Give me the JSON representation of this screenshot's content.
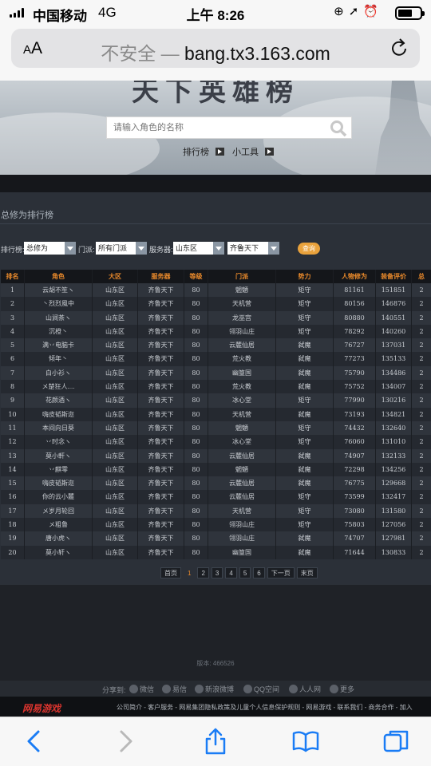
{
  "status_bar": {
    "carrier": "中国移动",
    "network": "4G",
    "time": "上午 8:26"
  },
  "address_bar": {
    "aa_big": "A",
    "aa_small": "A",
    "insecure": "不安全 — ",
    "domain": "bang.tx3.163.com"
  },
  "banner": {
    "title": "天下英雄榜",
    "search_placeholder": "请输入角色的名称",
    "links": [
      "排行榜",
      "小工具"
    ]
  },
  "panel": {
    "title": "总修为排行榜",
    "filters": {
      "rank_label": "排行榜:",
      "rank_value": "总修为",
      "school_label": "门派:",
      "school_value": "所有门派",
      "server_label": "服务器:",
      "region_value": "山东区",
      "server_value": "齐鲁天下",
      "query_button": "查询"
    }
  },
  "table": {
    "columns": [
      "排名",
      "角色",
      "大区",
      "服务器",
      "等级",
      "门派",
      "势力",
      "人物修为",
      "装备评价",
      "总"
    ],
    "rows": [
      [
        "1",
        "云胡不笙ヽ",
        "山东区",
        "齐鲁天下",
        "80",
        "魍魉",
        "矩守",
        "81161",
        "151851",
        "2"
      ],
      [
        "2",
        "丶烈烈風中",
        "山东区",
        "齐鲁天下",
        "80",
        "天机营",
        "矩守",
        "80156",
        "146876",
        "2"
      ],
      [
        "3",
        "山涧茶ヽ",
        "山东区",
        "齐鲁天下",
        "80",
        "龙巫宫",
        "矩守",
        "80880",
        "140551",
        "2"
      ],
      [
        "4",
        "沉橙丶",
        "山东区",
        "齐鲁天下",
        "80",
        "翎羽山庄",
        "矩守",
        "78292",
        "140260",
        "2"
      ],
      [
        "5",
        "满丷电脑卡",
        "山东区",
        "齐鲁天下",
        "80",
        "云麓仙居",
        "弑魔",
        "76727",
        "137031",
        "2"
      ],
      [
        "6",
        "倾年丶",
        "山东区",
        "齐鲁天下",
        "80",
        "荒火教",
        "弑魔",
        "77273",
        "135133",
        "2"
      ],
      [
        "7",
        "白小衫ヽ",
        "山东区",
        "齐鲁天下",
        "80",
        "幽篁国",
        "弑魔",
        "75790",
        "134486",
        "2"
      ],
      [
        "8",
        "メ楚狂人....",
        "山东区",
        "齐鲁天下",
        "80",
        "荒火教",
        "弑魔",
        "75752",
        "134007",
        "2"
      ],
      [
        "9",
        "花颜酒ヽ",
        "山东区",
        "齐鲁天下",
        "80",
        "冰心堂",
        "矩守",
        "77990",
        "130216",
        "2"
      ],
      [
        "10",
        "嗨皮韬斯迩",
        "山东区",
        "齐鲁天下",
        "80",
        "天机营",
        "弑魔",
        "73193",
        "134821",
        "2"
      ],
      [
        "11",
        "本间向日葵",
        "山东区",
        "齐鲁天下",
        "80",
        "魍魉",
        "矩守",
        "74432",
        "132640",
        "2"
      ],
      [
        "12",
        "丷时念ヽ",
        "山东区",
        "齐鲁天下",
        "80",
        "冰心堂",
        "矩守",
        "76060",
        "131010",
        "2"
      ],
      [
        "13",
        "莫小軒ヽ",
        "山东区",
        "齐鲁天下",
        "80",
        "云麓仙居",
        "弑魔",
        "74907",
        "132133",
        "2"
      ],
      [
        "14",
        "丷麒零",
        "山东区",
        "齐鲁天下",
        "80",
        "魍魉",
        "弑魔",
        "72298",
        "134256",
        "2"
      ],
      [
        "15",
        "嗨皮韬斯迩",
        "山东区",
        "齐鲁天下",
        "80",
        "云麓仙居",
        "弑魔",
        "76775",
        "129668",
        "2"
      ],
      [
        "16",
        "你的云小麓",
        "山东区",
        "齐鲁天下",
        "80",
        "云麓仙居",
        "矩守",
        "73599",
        "132417",
        "2"
      ],
      [
        "17",
        "メ岁月轮回",
        "山东区",
        "齐鲁天下",
        "80",
        "天机营",
        "矩守",
        "73080",
        "131580",
        "2"
      ],
      [
        "18",
        "メ粗鲁",
        "山东区",
        "齐鲁天下",
        "80",
        "翎羽山庄",
        "矩守",
        "75803",
        "127056",
        "2"
      ],
      [
        "19",
        "唐小虎ヽ",
        "山东区",
        "齐鲁天下",
        "80",
        "翎羽山庄",
        "弑魔",
        "74707",
        "127981",
        "2"
      ],
      [
        "20",
        "莫小轩ヽ",
        "山东区",
        "齐鲁天下",
        "80",
        "幽篁国",
        "弑魔",
        "71644",
        "130833",
        "2"
      ]
    ]
  },
  "pagination": {
    "first": "首页",
    "pages": [
      "1",
      "2",
      "3",
      "4",
      "5",
      "6"
    ],
    "next": "下一页",
    "last": "末页",
    "current": "1"
  },
  "footer": {
    "version": "版本: 466526",
    "share_label": "分享到:",
    "share_items": [
      "微信",
      "易信",
      "新浪微博",
      "QQ空间",
      "人人网",
      "更多"
    ],
    "links": "公司简介 - 客户服务 - 网易集团隐私政策及儿童个人信息保护规则 - 网易游戏 - 联系我们 - 商务合作 - 加入",
    "logo": "网易游戏"
  }
}
